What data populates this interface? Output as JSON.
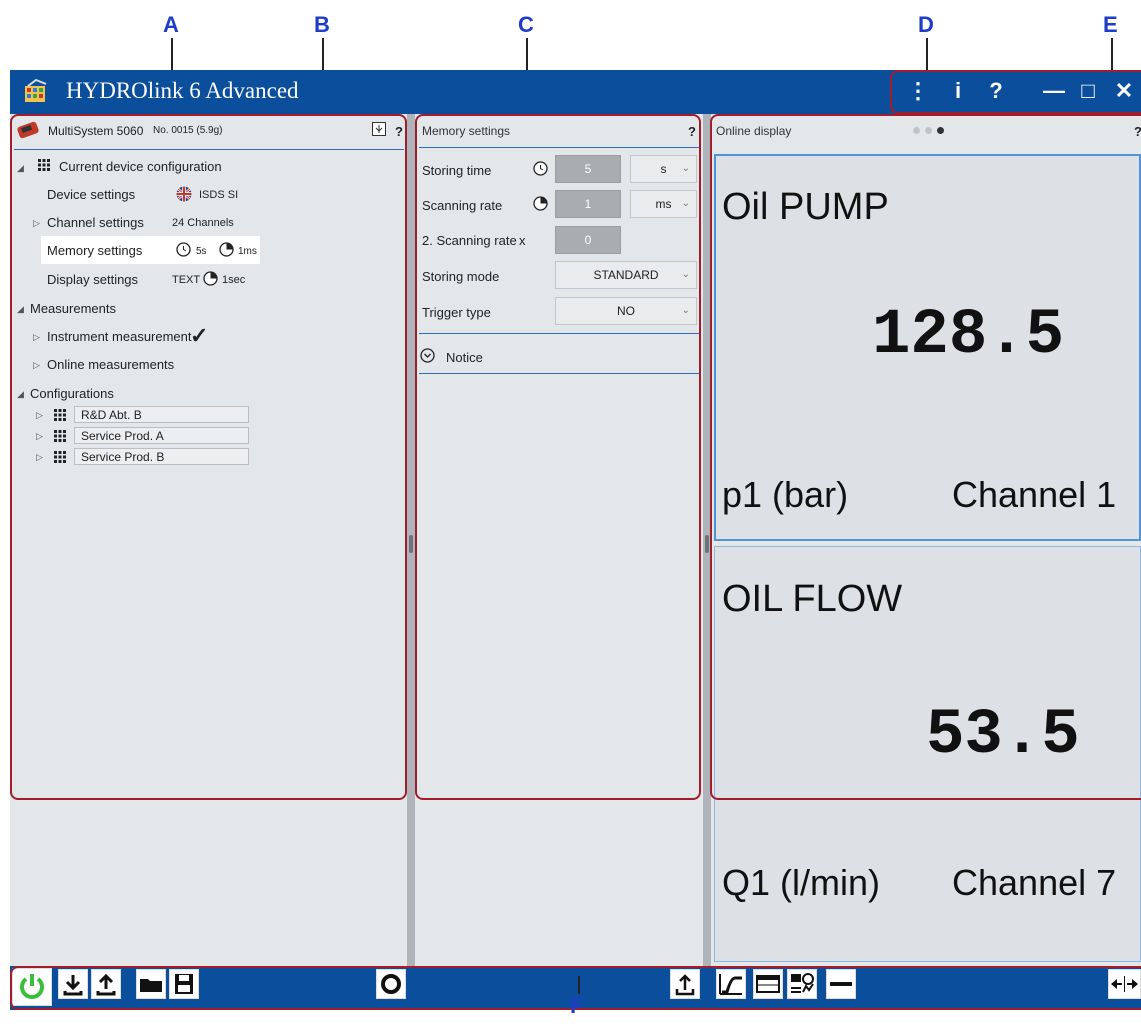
{
  "callouts": {
    "a": "A",
    "b": "B",
    "c": "C",
    "d": "D",
    "e": "E",
    "f": "F"
  },
  "app": {
    "title": "HYDROlink 6 Advanced"
  },
  "window_controls": {
    "menu": "⋮",
    "info": "i",
    "help": "?",
    "minimize": "—",
    "maximize": "□",
    "close": "✕"
  },
  "left_panel": {
    "device_name": "MultiSystem 5060",
    "device_no": "No. 0015 (5.9g)",
    "help": "?",
    "current_config": "Current device configuration",
    "device_settings": {
      "label": "Device settings",
      "value": "ISDS SI"
    },
    "channel_settings": {
      "label": "Channel settings",
      "value": "24 Channels"
    },
    "memory_settings": {
      "label": "Memory settings",
      "v1": "5s",
      "v2": "1ms"
    },
    "display_settings": {
      "label": "Display settings",
      "v1": "TEXT",
      "v2": "1sec"
    },
    "measurements": "Measurements",
    "instrument_measurement": "Instrument measurement",
    "checkmark": "✓",
    "online_measurements": "Online measurements",
    "configurations": "Configurations",
    "config_items": [
      "R&D Abt. B",
      "Service Prod. A",
      "Service Prod. B"
    ]
  },
  "middle_panel": {
    "title": "Memory settings",
    "help": "?",
    "storing_time": {
      "label": "Storing time",
      "value": "5",
      "unit": "s"
    },
    "scanning_rate": {
      "label": "Scanning rate",
      "value": "1",
      "unit": "ms"
    },
    "scanning_rate2": {
      "label": "2. Scanning rate",
      "x": "x",
      "value": "0"
    },
    "storing_mode": {
      "label": "Storing mode",
      "value": "STANDARD"
    },
    "trigger_type": {
      "label": "Trigger type",
      "value": "NO"
    },
    "notice": "Notice"
  },
  "right_panel": {
    "title": "Online display",
    "help": "?",
    "tile1": {
      "name": "Oil PUMP",
      "value": "128.5",
      "unit": "p1 (bar)",
      "channel": "Channel 1"
    },
    "tile2": {
      "name": "OIL FLOW",
      "value": "53.5",
      "unit": "Q1 (l/min)",
      "channel": "Channel 7"
    }
  },
  "colors": {
    "titlebar": "#0b4f9c",
    "callout": "#1f3cc9",
    "frame": "#a11d2b",
    "power": "#3bbf3b"
  }
}
